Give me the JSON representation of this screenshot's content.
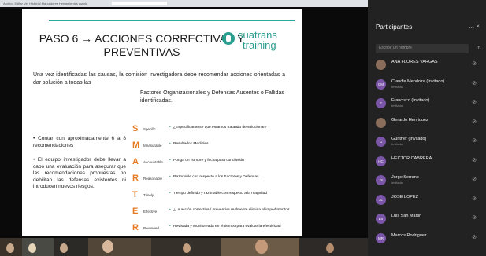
{
  "browser": {
    "tabs_text": "Archivo Editar Ver Historial Marcadores Herramientas Ayuda"
  },
  "slide": {
    "title": "PASO 6 → ACCIONES CORRECTIVAS Y PREVENTIVAS",
    "logo_line1": "suatrans",
    "logo_line2": "training",
    "intro": "Una vez identificadas las causas, la comisión investigadora debe recomendar acciones orientadas a dar solución a todas las",
    "intro_continued": "Factores Organizacionales y Defensas Ausentes o Fallidas identificadas.",
    "bullets": [
      "• Contar con aproximadamente 6 a 8 recomendaciones",
      "• El equipo investigador debe llevar a cabo una evaluación para asegurar que las recomendaciones propuestas no debilitan las defensas existentes ni introducen nuevos riesgos."
    ],
    "smart": [
      {
        "letter": "S",
        "word": "Specific",
        "desc": "¿Específicamente que estamos tratando de solucionar?"
      },
      {
        "letter": "M",
        "word": "Measurable",
        "desc": "Resultados Medibles"
      },
      {
        "letter": "A",
        "word": "Accountable",
        "desc": "Ponga un nombre y fecha para conclusión"
      },
      {
        "letter": "R",
        "word": "Reasonable",
        "desc": "Razonable con respecto a los Factores y Defensas"
      },
      {
        "letter": "T",
        "word": "Timely",
        "desc": "Tiempo definido y razonable con respecto a la magnitud"
      },
      {
        "letter": "E",
        "word": "Effective",
        "desc": "¿La acción correctiva / preventiva realmente elimina el impedimento?"
      },
      {
        "letter": "R",
        "word": "Reviewed",
        "desc": "Revisada y Monitoreada en el tiempo para evaluar la efectividad"
      }
    ]
  },
  "participants": {
    "title": "Participantes",
    "controls": "... ×",
    "search_placeholder": "Escribir un nombre",
    "items": [
      {
        "name": "ANA FLORES VARGAS",
        "sub": "",
        "initials": "",
        "kind": "pic"
      },
      {
        "name": "Claudia Mendoza (Invitado)",
        "sub": "Invitado",
        "initials": "CM",
        "kind": "ini"
      },
      {
        "name": "Francisco (Invitado)",
        "sub": "Invitado",
        "initials": "F",
        "kind": "ini"
      },
      {
        "name": "Gerardo Henriquez",
        "sub": "",
        "initials": "",
        "kind": "pic"
      },
      {
        "name": "Gunther (Invitado)",
        "sub": "Invitado",
        "initials": "G",
        "kind": "ini"
      },
      {
        "name": "HECTOR CABRERA",
        "sub": "",
        "initials": "HC",
        "kind": "ini"
      },
      {
        "name": "Jorge Serrano",
        "sub": "Invitado",
        "initials": "JS",
        "kind": "ini"
      },
      {
        "name": "JOSE LOPEZ",
        "sub": "",
        "initials": "JL",
        "kind": "ini"
      },
      {
        "name": "Luis San Martin",
        "sub": "",
        "initials": "LS",
        "kind": "ini"
      },
      {
        "name": "Marcos Rodriguez",
        "sub": "",
        "initials": "MR",
        "kind": "ini"
      }
    ]
  }
}
